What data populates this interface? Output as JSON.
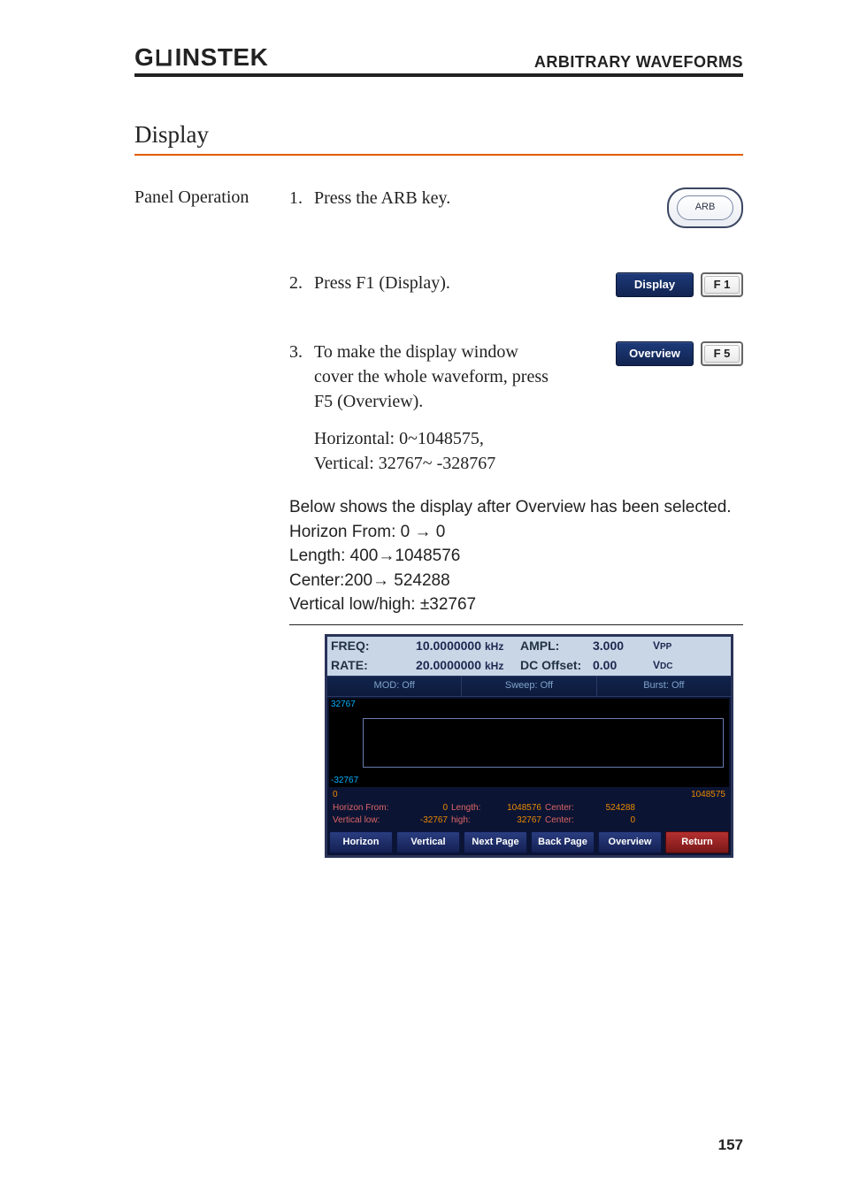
{
  "header": {
    "logo_left": "G",
    "logo_u": "W",
    "logo_rest": "INSTEK",
    "right": "ARBITRARY WAVEFORMS"
  },
  "section_title": "Display",
  "panel_label": "Panel Operation",
  "steps": {
    "s1_num": "1.",
    "s1_text": "Press the ARB key.",
    "arb_label": "ARB",
    "s2_num": "2.",
    "s2_text": "Press F1 (Display).",
    "display_btn": "Display",
    "f1": "F 1",
    "s3_num": "3.",
    "s3_text": "To make the display window cover the whole waveform, press F5 (Overview).",
    "overview_btn": "Overview",
    "f5": "F 5",
    "range1": "Horizontal: 0~1048575,",
    "range2": "Vertical: 32767~ -328767"
  },
  "below": {
    "l1": "Below shows the display after Overview has been selected.",
    "l2a": "Horizon From: 0 ",
    "l2b": " 0",
    "l3a": "Length: 400",
    "l3b": "1048576",
    "l4a": "Center:200",
    "l4b": " 524288",
    "l5": "Vertical low/high: ±32767"
  },
  "screenshot": {
    "top": {
      "freq_lbl": "FREQ:",
      "freq_val": "10.0000000",
      "freq_unit": "kHz",
      "ampl_lbl": "AMPL:",
      "ampl_val": "3.000",
      "ampl_unit": "VPP",
      "rate_lbl": "RATE:",
      "rate_val": "20.0000000",
      "rate_unit": "kHz",
      "dc_lbl": "DC Offset:",
      "dc_val": "0.00",
      "dc_unit": "VDC"
    },
    "tabs": {
      "mod": "MOD: Off",
      "sweep": "Sweep: Off",
      "burst": "Burst: Off"
    },
    "plot": {
      "ytop": "32767",
      "ybot": "-32767",
      "xleft": "0",
      "xright": "1048575"
    },
    "params": {
      "hf_k": "Horizon From:",
      "hf_v": "0",
      "len_k": "Length:",
      "len_v": "1048576",
      "ctr_k": "Center:",
      "ctr_v": "524288",
      "vl_k": "Vertical low:",
      "vl_v": "-32767",
      "hi_k": "high:",
      "hi_v": "32767",
      "ctr2_k": "Center:",
      "ctr2_v": "0"
    },
    "softkeys": {
      "k1": "Horizon",
      "k2": "Vertical",
      "k3": "Next Page",
      "k4": "Back Page",
      "k5": "Overview",
      "k6": "Return"
    }
  },
  "page_number": "157"
}
